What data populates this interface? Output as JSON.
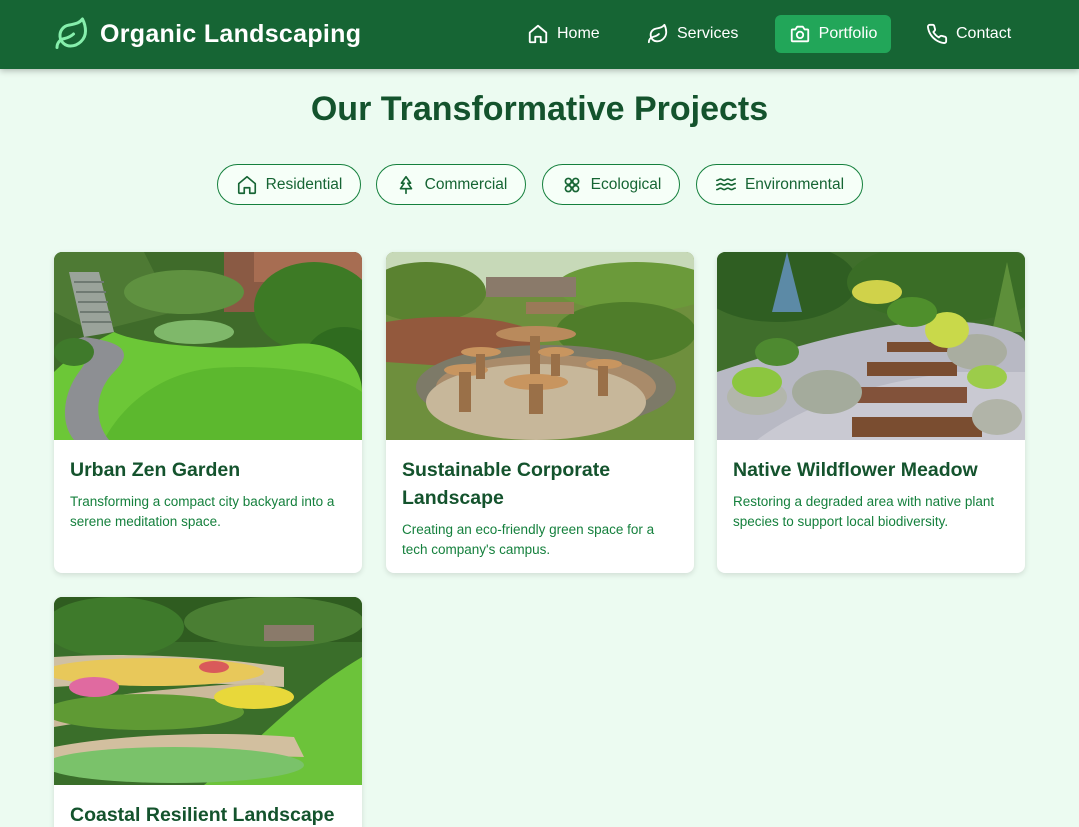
{
  "header": {
    "brand_icon": "leaf-icon",
    "brand_title": "Organic Landscaping",
    "nav": [
      {
        "label": "Home",
        "icon": "home-icon"
      },
      {
        "label": "Services",
        "icon": "leaf-icon"
      },
      {
        "label": "Portfolio",
        "icon": "camera-icon",
        "active": true
      },
      {
        "label": "Contact",
        "icon": "phone-icon"
      }
    ]
  },
  "page_title": "Our Transformative Projects",
  "filters": [
    {
      "label": "Residential",
      "icon": "home-icon"
    },
    {
      "label": "Commercial",
      "icon": "tree-icon"
    },
    {
      "label": "Ecological",
      "icon": "flower-icon"
    },
    {
      "label": "Environmental",
      "icon": "waves-icon"
    }
  ],
  "projects": [
    {
      "title": "Urban Zen Garden",
      "description": "Transforming a compact city backyard into a serene meditation space."
    },
    {
      "title": "Sustainable Corporate Landscape",
      "description": "Creating an eco-friendly green space for a tech company's campus."
    },
    {
      "title": "Native Wildflower Meadow",
      "description": "Restoring a degraded area with native plant species to support local biodiversity."
    },
    {
      "title": "Coastal Resilient Landscape",
      "description": ""
    }
  ],
  "colors": {
    "header_bg": "#166534",
    "active_nav": "#22a659",
    "page_bg": "#ecfbf1",
    "title": "#14532d",
    "accent": "#15803d"
  }
}
